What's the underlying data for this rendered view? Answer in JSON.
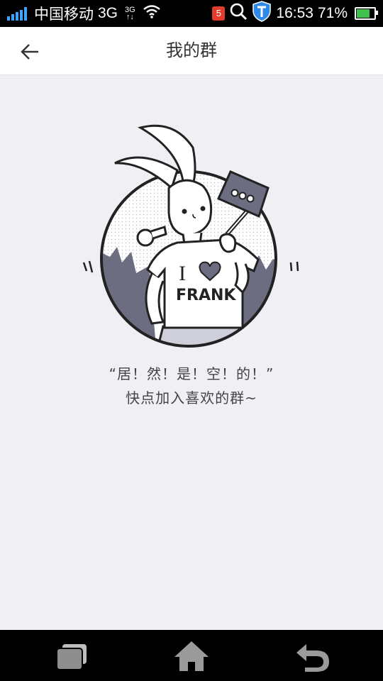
{
  "status_bar": {
    "carrier": "中国移动",
    "network": "3G",
    "network_small_top": "3G",
    "network_small_bottom": "↑↓",
    "notification_count": "5",
    "time": "16:53",
    "battery": "71%",
    "battery_level": 0.71,
    "colors": {
      "signal": "#3ea3ff",
      "battery": "#3ec24d",
      "badge": "#e23c2c"
    }
  },
  "header": {
    "title": "我的群",
    "back_icon": "arrow-left-icon"
  },
  "empty_state": {
    "illustration_text_line1": "I",
    "illustration_text_line2": "FRANK",
    "message_line1": "“居！然！是！空！的！”",
    "message_line2": "快点加入喜欢的群~"
  },
  "nav_bar": {
    "recent_icon": "recent-apps-icon",
    "home_icon": "home-icon",
    "back_icon": "back-icon"
  }
}
